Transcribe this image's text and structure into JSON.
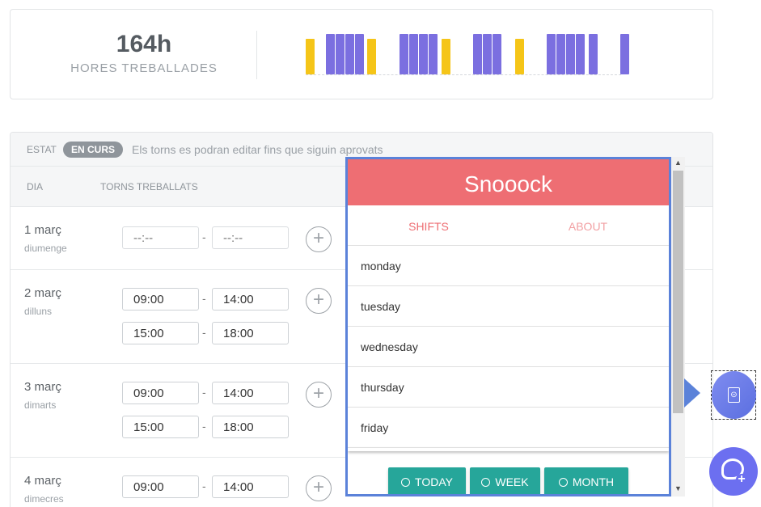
{
  "summary": {
    "hours_value": "164h",
    "hours_label": "HORES TREBALLADES",
    "bar_colors": {
      "worked": "#7b6fe0",
      "partial": "#f5c518"
    }
  },
  "status": {
    "label": "ESTAT",
    "badge": "EN CURS",
    "note": "Els torns es podran editar fins que siguin aprovats"
  },
  "columns": {
    "day": "DIA",
    "shifts": "TORNS TREBALLATS"
  },
  "days": [
    {
      "name": "1 març",
      "weekday": "diumenge",
      "shifts": [
        {
          "start": "",
          "end": ""
        }
      ]
    },
    {
      "name": "2 març",
      "weekday": "dilluns",
      "shifts": [
        {
          "start": "09:00",
          "end": "14:00"
        },
        {
          "start": "15:00",
          "end": "18:00"
        }
      ]
    },
    {
      "name": "3 març",
      "weekday": "dimarts",
      "shifts": [
        {
          "start": "09:00",
          "end": "14:00"
        },
        {
          "start": "15:00",
          "end": "18:00"
        }
      ]
    },
    {
      "name": "4 març",
      "weekday": "dimecres",
      "shifts": [
        {
          "start": "09:00",
          "end": "14:00"
        }
      ]
    }
  ],
  "time_placeholder": "--:--",
  "dash": "-",
  "plus": "+",
  "popup": {
    "title": "Snooock",
    "tabs": [
      "SHIFTS",
      "ABOUT"
    ],
    "items": [
      "monday",
      "tuesday",
      "wednesday",
      "thursday",
      "friday"
    ],
    "buttons": [
      "TODAY",
      "WEEK",
      "MONTH"
    ],
    "header_color": "#ee6e73",
    "button_color": "#26a69a"
  },
  "scroll_arrows": {
    "up": "▲",
    "down": "▼"
  }
}
